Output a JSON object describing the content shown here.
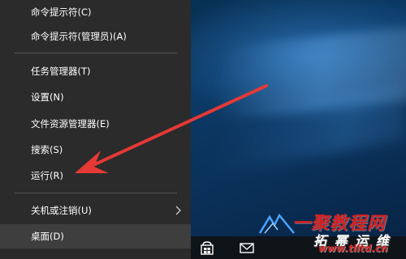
{
  "menu": {
    "items": [
      {
        "label": "命令提示符(C)"
      },
      {
        "label": "命令提示符(管理员)(A)"
      },
      {
        "label": "任务管理器(T)"
      },
      {
        "label": "设置(N)"
      },
      {
        "label": "文件资源管理器(E)"
      },
      {
        "label": "搜索(S)"
      },
      {
        "label": "运行(R)"
      },
      {
        "label": "关机或注销(U)"
      },
      {
        "label": "桌面(D)"
      }
    ]
  },
  "taskbar": {
    "icons": [
      "store-icon",
      "mail-icon"
    ]
  },
  "watermark": {
    "title": "一聚教程网",
    "subtitle": "拓 幂 运 维",
    "url": "www.tlltd.cn"
  },
  "colors": {
    "menu_bg": "#2b2b2b",
    "menu_text": "#ffffff",
    "hover_bg": "#3e3e3e",
    "arrow": "#e53935",
    "desktop": "#0b3a66"
  }
}
